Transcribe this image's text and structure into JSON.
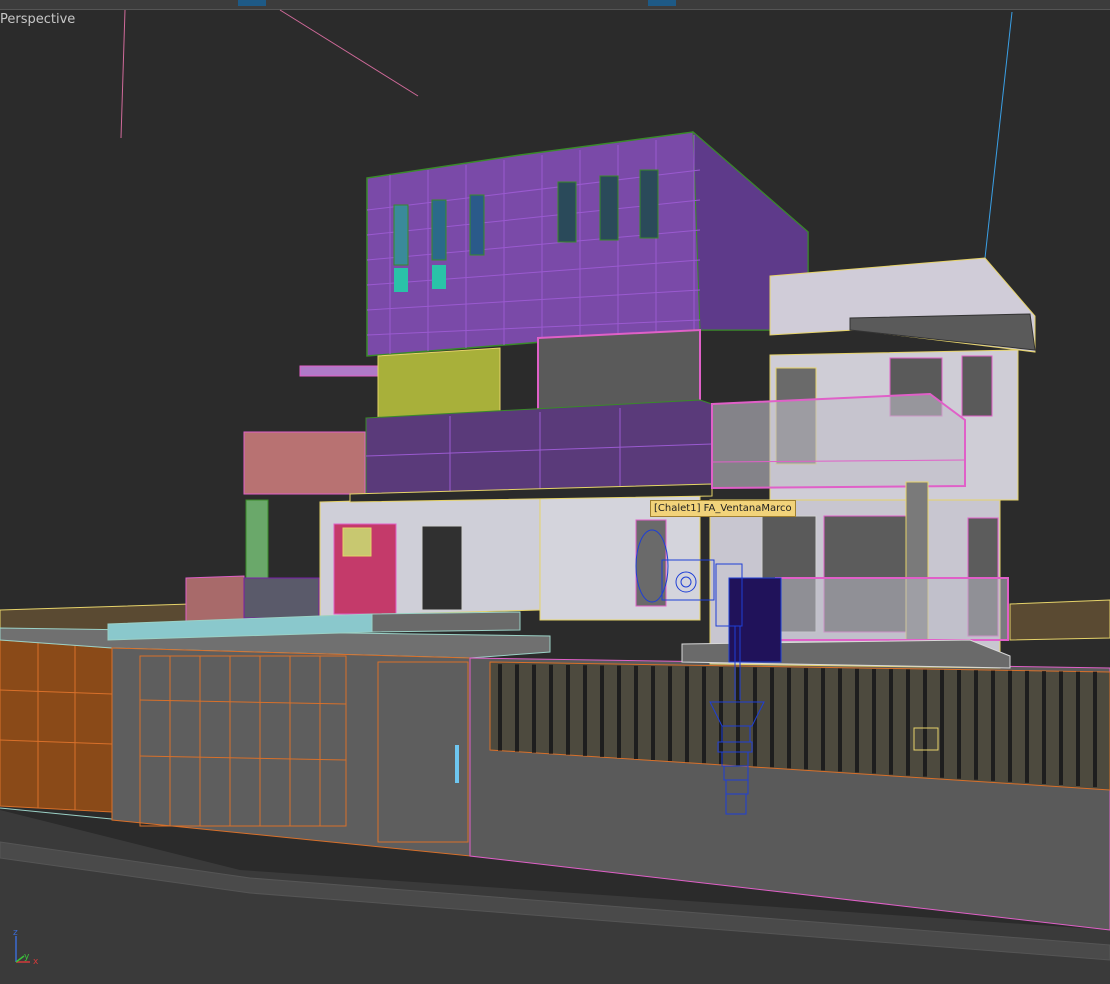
{
  "viewport": {
    "label": "Perspective"
  },
  "tooltip": {
    "text": "[Chalet1] FA_VentanaMarco"
  },
  "axis": {
    "x_label": "x",
    "y_label": "y",
    "z_label": "z",
    "x_color": "#d23a3a",
    "y_color": "#3ac23a",
    "z_color": "#3a6ad2"
  },
  "colors": {
    "background": "#2b2b2b",
    "wire_purple": "#7a1fa8",
    "wire_green": "#3a8a2a",
    "wire_pink": "#e060c8",
    "wire_orange": "#d8702a",
    "wire_blue": "#1e3fd6",
    "wire_yellow": "#e6d36a"
  },
  "icons": [
    "axis-gizmo-icon"
  ]
}
